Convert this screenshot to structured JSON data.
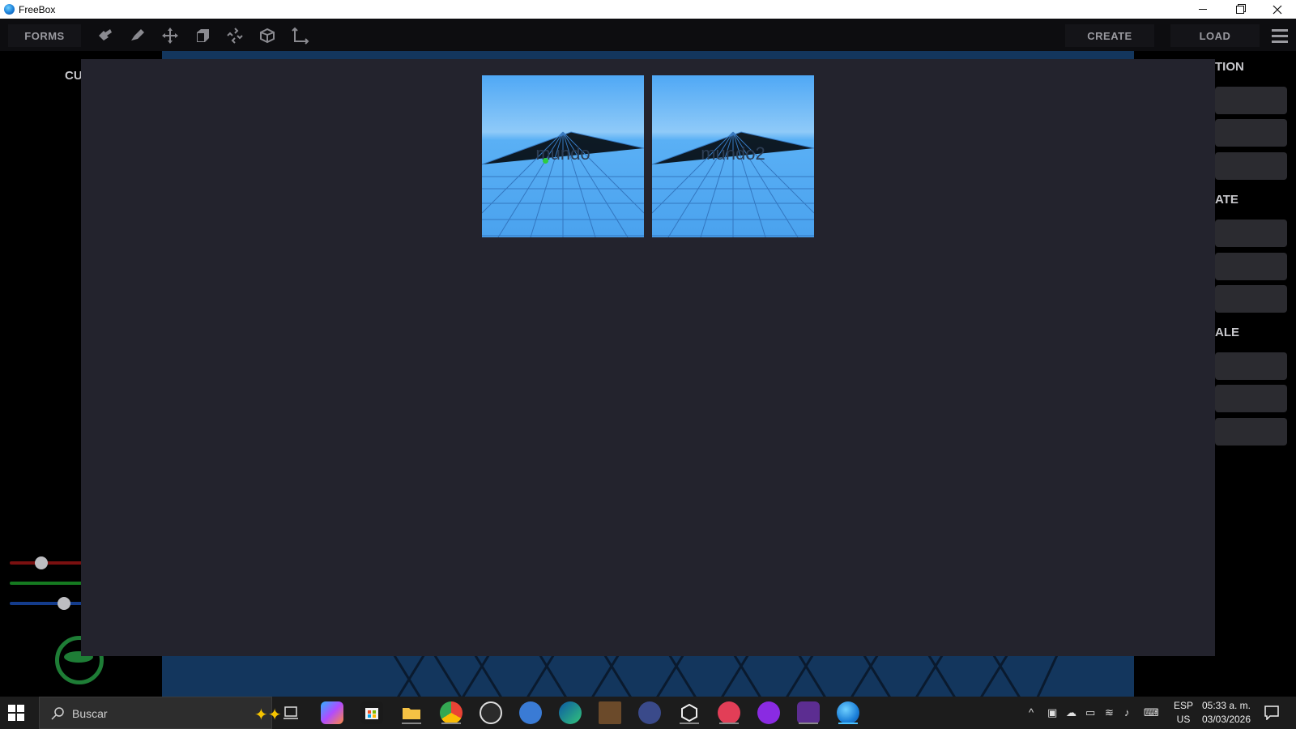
{
  "window": {
    "title": "FreeBox"
  },
  "toolbar": {
    "forms_label": "FORMS",
    "create_label": "CREATE",
    "load_label": "LOAD",
    "tools": [
      "select-icon",
      "paint-icon",
      "move-icon",
      "box-icon",
      "rotate-icon",
      "scale-icon",
      "axis-icon"
    ]
  },
  "left_panel": {
    "partial_label": "CU"
  },
  "right_panel": {
    "labels": [
      "TION",
      "ATE",
      "ALE"
    ]
  },
  "load_dialog": {
    "worlds": [
      {
        "name": "mundo"
      },
      {
        "name": "mundo2"
      }
    ]
  },
  "taskbar": {
    "search_placeholder": "Buscar",
    "lang_line1": "ESP",
    "lang_line2": "US",
    "time": "05:33 a. m.",
    "date": "03/03/2026"
  },
  "colors": {
    "modal_bg": "#23232d",
    "sky_top": "#4fa8f5",
    "sky_horizon": "#8fcaf8",
    "viewport_bg": "#13365d"
  }
}
